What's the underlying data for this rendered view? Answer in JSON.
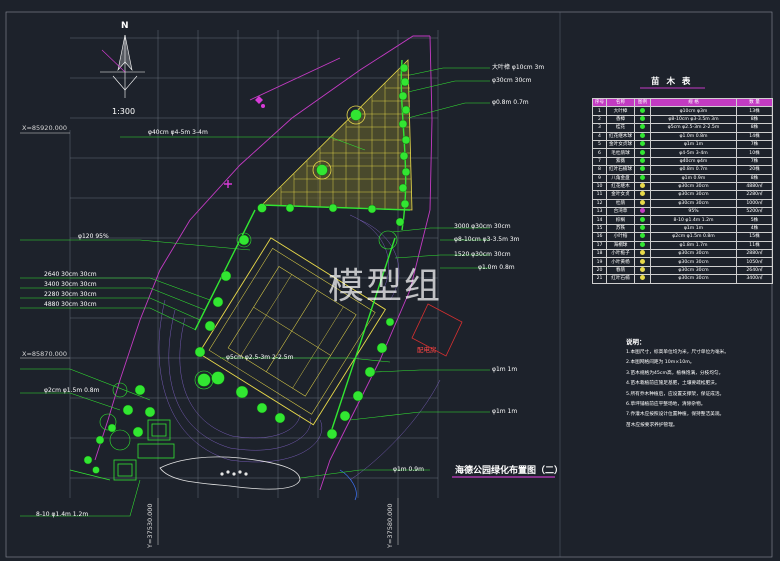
{
  "drawing_title": "海德公园绿化布置图（二）",
  "scale": "1:300",
  "north_letter": "N",
  "watermark": "模型组",
  "substation_label": "配电房",
  "coordinates": {
    "x_top": "X=85920.000",
    "x_mid": "X=85870.000",
    "y_left": "Y=37530.000",
    "y_right": "Y=37580.000"
  },
  "labels": {
    "top1": "大叶樟  φ10cm  3m",
    "top2": "φ30cm  30cm",
    "top3": "φ0.8m  0.7m",
    "leftA": "φ40cm  φ4-5m  3-4m",
    "leftB": "φ120  95%",
    "left1": "2640  30cm  30cm",
    "left2": "3400  30cm  30cm",
    "left3": "2280  30cm  30cm",
    "left4": "4880  30cm  30cm",
    "left5": "φ2cm  φ1.5m  0.8m",
    "bottom_left": "8-10  φ1.4m  1.2m",
    "mid1": "3000  φ30cm  30cm",
    "mid2": "φ8-10cm  φ3-3.5m  3m",
    "mid3": "1520  φ30cm  30cm",
    "mid4": "φ1.0m  0.8m",
    "court": "φ5cm  φ2.5-3m  2-2.5m",
    "right1": "φ1m  1m",
    "right2": "φ1m  1m",
    "bottom_mid": "φ1m  0.9m"
  },
  "table": {
    "title": "苗 木 表",
    "headers": [
      "序号",
      "名称",
      "图例",
      "规    格",
      "数  量"
    ],
    "rows": [
      [
        "1",
        "大叶樟",
        "",
        "φ10cm  φ3m",
        "13株"
      ],
      [
        "2",
        "香樟",
        "",
        "φ8-10cm  φ3-3.5m  3m",
        "8株"
      ],
      [
        "3",
        "桂花",
        "",
        "φ5cm  φ2.5-3m  2-2.5m",
        "8株"
      ],
      [
        "4",
        "红花继木球",
        "",
        "φ1.0m  0.8m",
        "14株"
      ],
      [
        "5",
        "金叶女贞球",
        "",
        "φ1m  1m",
        "7株"
      ],
      [
        "6",
        "毛杜鹃球",
        "",
        "φ4-5m  3-4m",
        "10株"
      ],
      [
        "7",
        "紫薇",
        "",
        "φ40cm  φ4m",
        "7株"
      ],
      [
        "8",
        "红叶石楠球",
        "",
        "φ0.8m  0.7m",
        "20株"
      ],
      [
        "9",
        "八角金盘",
        "",
        "φ1m  0.9m",
        "8株"
      ],
      [
        "10",
        "红花继木",
        "",
        "φ30cm  30cm",
        "4880㎡"
      ],
      [
        "11",
        "金叶女贞",
        "",
        "φ30cm  30cm",
        "2280㎡"
      ],
      [
        "12",
        "杜鹃",
        "",
        "φ30cm  30cm",
        "1000㎡"
      ],
      [
        "13",
        "台湾草",
        "",
        "95%",
        "5200㎡"
      ],
      [
        "14",
        "棕榈",
        "",
        "8-10  φ1.4m  1.2m",
        "5株"
      ],
      [
        "15",
        "苏铁",
        "",
        "φ1m  1m",
        "4株"
      ],
      [
        "16",
        "小叶榕",
        "",
        "φ2cm  φ1.5m  0.8m",
        "15株"
      ],
      [
        "17",
        "海桐球",
        "",
        "φ1.8m  1.7m",
        "11株"
      ],
      [
        "18",
        "小叶栀子",
        "",
        "φ30cm  30cm",
        "2880㎡"
      ],
      [
        "19",
        "小叶黄杨",
        "",
        "φ30cm  30cm",
        "1050㎡"
      ],
      [
        "20",
        "春鹃",
        "",
        "φ30cm  30cm",
        "2640㎡"
      ],
      [
        "21",
        "红叶石楠",
        "",
        "φ30cm  30cm",
        "3400㎡"
      ]
    ]
  },
  "notes": {
    "title": "说明：",
    "items": [
      "1.本图尺寸，标高单位均为米，尺寸单位为毫米。",
      "2.本图网格间距为          10m×10m。",
      "3.苗木规格为45cm高，植株饱满，分枝均匀。",
      "4.苗木栽植前应施足基肥，土壤要疏松肥沃。",
      "5.所有乔木种植后，应设置支撑架，保证成活。",
      "6.草坪铺植前应平整场地，清除杂物。",
      "7.乔灌木应按照设计位置种植，保持整洁美观。",
      "  苗木应按要求养护管理。"
    ]
  },
  "colors": {
    "background": "#1d222b",
    "grid": "#6b7080",
    "site_outline": "#c43bc4",
    "paving": "#e8d94a",
    "trees": "#32e632",
    "leader": "#32e632",
    "substation": "#d93030"
  }
}
